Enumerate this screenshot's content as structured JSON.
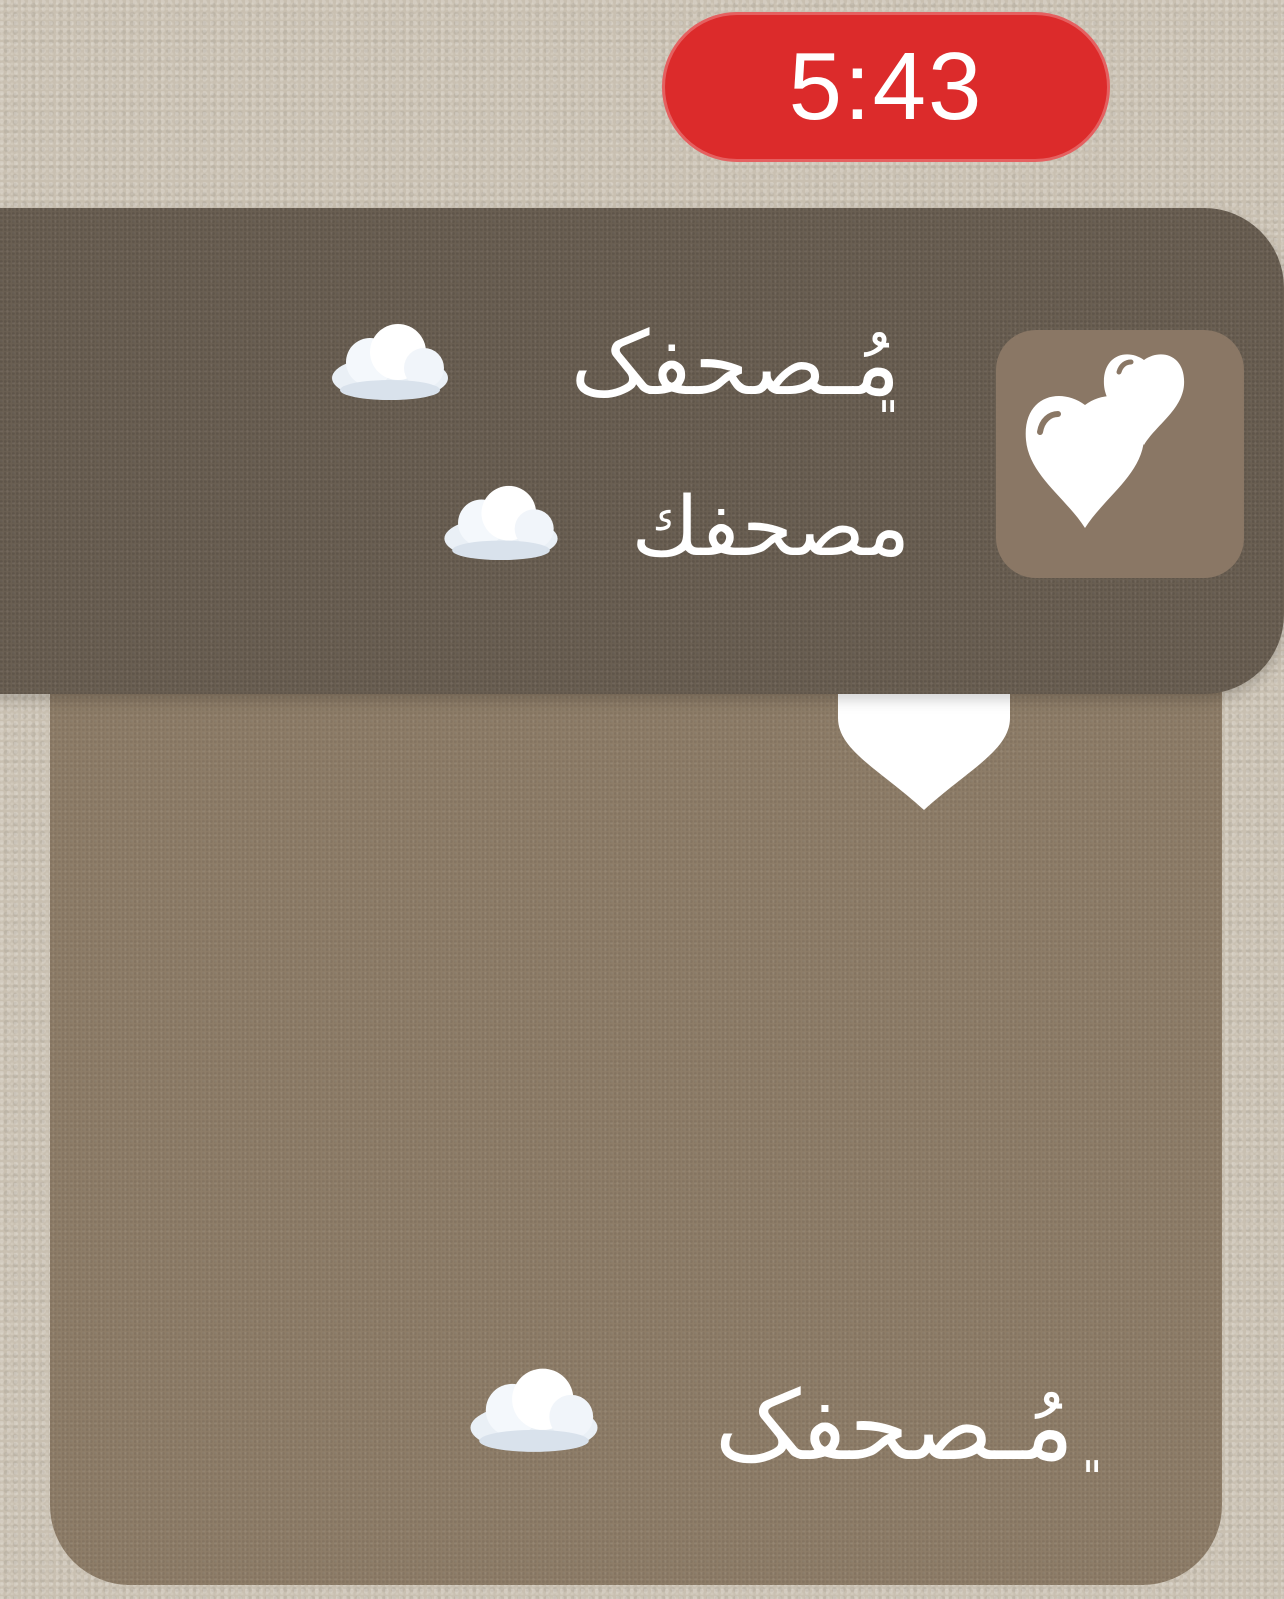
{
  "status": {
    "time": "5:43",
    "time_pill_color": "#dc2b2b"
  },
  "widget": {
    "app_icon": "two-hearts-icon",
    "line_1": "مُـصحفک",
    "line_2": "مصحفك",
    "line_3": "مُـصحفک",
    "quote_mark": "\"",
    "cloud_icon": "cloud-icon",
    "heart_icon": "heart-icon",
    "banner_color": "#6a5f52",
    "card_color": "#8e7d68",
    "background_color": "#c9c0b1"
  }
}
